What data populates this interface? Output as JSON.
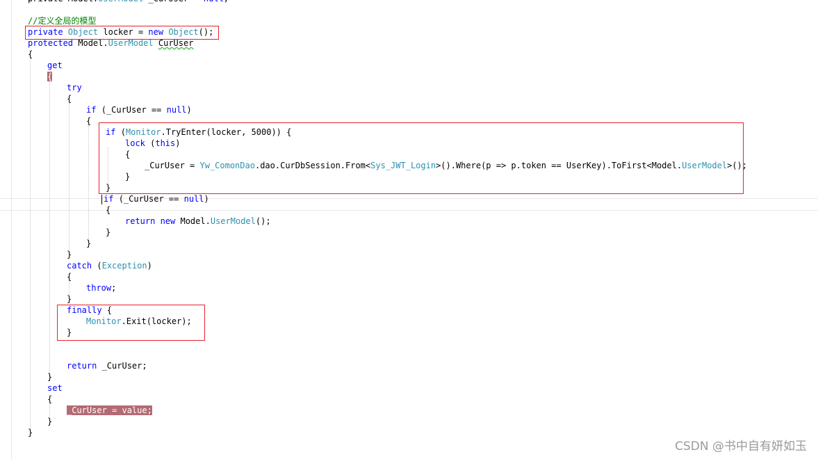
{
  "lines": [
    {
      "id": "l0",
      "tokens": [
        {
          "t": "private ",
          "c": "plain"
        },
        {
          "t": "Model.",
          "c": "plain"
        },
        {
          "t": "UserModel",
          "c": "ty"
        },
        {
          "t": " _CurUser = ",
          "c": "plain"
        },
        {
          "t": "null",
          "c": "kw"
        },
        {
          "t": ";",
          "c": "plain"
        }
      ]
    },
    {
      "id": "l1",
      "tokens": [
        {
          "t": "//定义全局的模型",
          "c": "cm"
        }
      ]
    },
    {
      "id": "l2",
      "tokens": [
        {
          "t": "private ",
          "c": "kw"
        },
        {
          "t": "Object",
          "c": "ty"
        },
        {
          "t": " locker = ",
          "c": "plain"
        },
        {
          "t": "new ",
          "c": "kw"
        },
        {
          "t": "Object",
          "c": "ty"
        },
        {
          "t": "();",
          "c": "plain"
        }
      ]
    },
    {
      "id": "l3",
      "tokens": [
        {
          "t": "protected ",
          "c": "kw"
        },
        {
          "t": "Model.",
          "c": "plain"
        },
        {
          "t": "UserModel",
          "c": "ty"
        },
        {
          "t": " ",
          "c": "plain"
        },
        {
          "t": "CurUser",
          "c": "plain squiggle"
        }
      ]
    },
    {
      "id": "l4",
      "tokens": [
        {
          "t": "{",
          "c": "plain"
        }
      ]
    },
    {
      "id": "l5",
      "tokens": [
        {
          "t": "get",
          "c": "kw"
        }
      ]
    },
    {
      "id": "l6",
      "tokens": [
        {
          "t": "{",
          "c": "hl"
        }
      ]
    },
    {
      "id": "l7",
      "tokens": [
        {
          "t": "try",
          "c": "kw"
        }
      ]
    },
    {
      "id": "l8",
      "tokens": [
        {
          "t": "{",
          "c": "plain"
        }
      ]
    },
    {
      "id": "l9",
      "tokens": [
        {
          "t": "if ",
          "c": "kw"
        },
        {
          "t": "(_CurUser == ",
          "c": "plain"
        },
        {
          "t": "null",
          "c": "kw"
        },
        {
          "t": ")",
          "c": "plain"
        }
      ]
    },
    {
      "id": "l10",
      "tokens": [
        {
          "t": "{",
          "c": "plain"
        }
      ]
    },
    {
      "id": "l11",
      "tokens": [
        {
          "t": "if ",
          "c": "kw"
        },
        {
          "t": "(",
          "c": "plain"
        },
        {
          "t": "Monitor",
          "c": "ty"
        },
        {
          "t": ".TryEnter(locker, 5000)) {",
          "c": "plain"
        }
      ]
    },
    {
      "id": "l12",
      "tokens": [
        {
          "t": "lock ",
          "c": "kw"
        },
        {
          "t": "(",
          "c": "plain"
        },
        {
          "t": "this",
          "c": "kw"
        },
        {
          "t": ")",
          "c": "plain"
        }
      ]
    },
    {
      "id": "l13",
      "tokens": [
        {
          "t": "{",
          "c": "plain"
        }
      ]
    },
    {
      "id": "l14",
      "tokens": [
        {
          "t": "_CurUser = ",
          "c": "plain"
        },
        {
          "t": "Yw_ComonDao",
          "c": "ty squiggle-none"
        },
        {
          "t": ".dao.CurDbSession.From<",
          "c": "plain"
        },
        {
          "t": "Sys_JWT_Login",
          "c": "ty"
        },
        {
          "t": ">().Where(p => p.token == UserKey).ToFirst<Model.",
          "c": "plain"
        },
        {
          "t": "UserModel",
          "c": "ty"
        },
        {
          "t": ">();",
          "c": "plain"
        }
      ]
    },
    {
      "id": "l15",
      "tokens": [
        {
          "t": "}",
          "c": "plain"
        }
      ]
    },
    {
      "id": "l16",
      "tokens": [
        {
          "t": "}",
          "c": "plain"
        }
      ]
    },
    {
      "id": "l17",
      "tokens": [
        {
          "t": "if ",
          "c": "kw"
        },
        {
          "t": "(_CurUser == ",
          "c": "plain"
        },
        {
          "t": "null",
          "c": "kw"
        },
        {
          "t": ")",
          "c": "plain"
        }
      ]
    },
    {
      "id": "l18",
      "tokens": [
        {
          "t": "{",
          "c": "plain"
        }
      ]
    },
    {
      "id": "l19",
      "tokens": [
        {
          "t": "return ",
          "c": "kw"
        },
        {
          "t": "new ",
          "c": "kw"
        },
        {
          "t": "Model.",
          "c": "plain"
        },
        {
          "t": "UserModel",
          "c": "ty"
        },
        {
          "t": "();",
          "c": "plain"
        }
      ]
    },
    {
      "id": "l20",
      "tokens": [
        {
          "t": "}",
          "c": "plain"
        }
      ]
    },
    {
      "id": "l21",
      "tokens": [
        {
          "t": "}",
          "c": "plain"
        }
      ]
    },
    {
      "id": "l22",
      "tokens": [
        {
          "t": "}",
          "c": "plain"
        }
      ]
    },
    {
      "id": "l23",
      "tokens": [
        {
          "t": "catch ",
          "c": "kw"
        },
        {
          "t": "(",
          "c": "plain"
        },
        {
          "t": "Exception",
          "c": "ty"
        },
        {
          "t": ")",
          "c": "plain"
        }
      ]
    },
    {
      "id": "l24",
      "tokens": [
        {
          "t": "{",
          "c": "plain"
        }
      ]
    },
    {
      "id": "l25",
      "tokens": [
        {
          "t": "throw",
          "c": "kw"
        },
        {
          "t": ";",
          "c": "plain"
        }
      ]
    },
    {
      "id": "l26",
      "tokens": [
        {
          "t": "}",
          "c": "plain"
        }
      ]
    },
    {
      "id": "l27",
      "tokens": [
        {
          "t": "finally ",
          "c": "kw"
        },
        {
          "t": "{",
          "c": "plain"
        }
      ]
    },
    {
      "id": "l28",
      "tokens": [
        {
          "t": "Monitor",
          "c": "ty"
        },
        {
          "t": ".Exit(locker);",
          "c": "plain"
        }
      ]
    },
    {
      "id": "l29",
      "tokens": [
        {
          "t": "}",
          "c": "plain"
        }
      ]
    },
    {
      "id": "l30",
      "tokens": [
        {
          "t": "return ",
          "c": "kw"
        },
        {
          "t": "_CurUser;",
          "c": "plain"
        }
      ]
    },
    {
      "id": "l31",
      "tokens": [
        {
          "t": "}",
          "c": "plain"
        }
      ]
    },
    {
      "id": "l32",
      "tokens": [
        {
          "t": "set",
          "c": "kw"
        }
      ]
    },
    {
      "id": "l33",
      "tokens": [
        {
          "t": "{",
          "c": "plain"
        }
      ]
    },
    {
      "id": "l34",
      "tokens": [
        {
          "t": "_CurUser = value;",
          "c": "hl"
        }
      ]
    },
    {
      "id": "l35",
      "tokens": [
        {
          "t": "}",
          "c": "plain"
        }
      ]
    },
    {
      "id": "l36",
      "tokens": [
        {
          "t": "}",
          "c": "plain"
        }
      ]
    }
  ],
  "watermark": "CSDN @书中自有妍如玉",
  "colors": {
    "keyword": "#0000ff",
    "type": "#2b91af",
    "comment": "#008000",
    "highlight": "#b46a74",
    "annotation_box": "#e8212b"
  }
}
